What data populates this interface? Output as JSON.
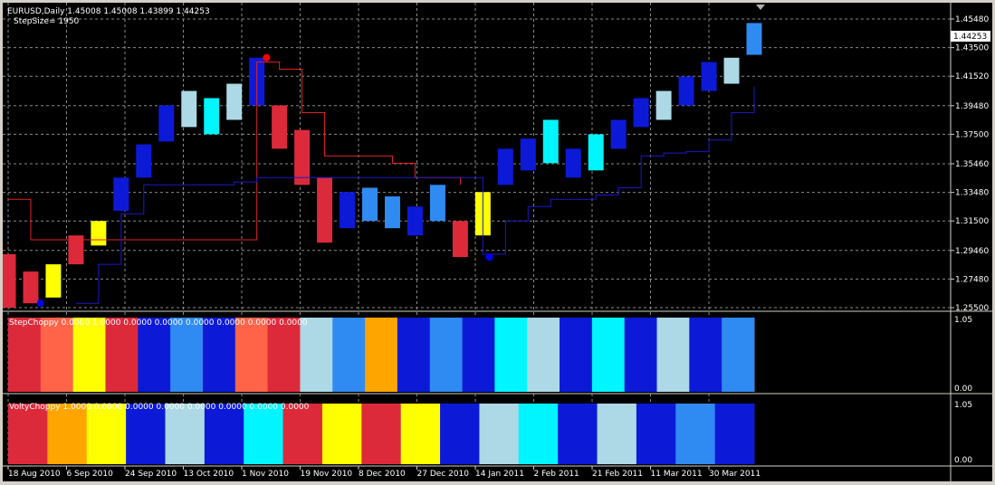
{
  "chart_data": {
    "type": "bar",
    "symbol_line": "EURUSD,Daily  1.45008 1.45008 1.43899 1.44253",
    "step_size_label": "StepSize= 1950",
    "current_price": "1.44253",
    "y_ticks": [
      "1.45480",
      "1.43500",
      "1.41520",
      "1.39480",
      "1.37500",
      "1.35460",
      "1.33480",
      "1.31500",
      "1.29460",
      "1.27480",
      "1.25500"
    ],
    "x_ticks": [
      "18 Aug 2010",
      "6 Sep 2010",
      "24 Sep 2010",
      "13 Oct 2010",
      "1 Nov 2010",
      "19 Nov 2010",
      "8 Dec 2010",
      "27 Dec 2010",
      "14 Jan 2011",
      "2 Feb 2011",
      "21 Feb 2011",
      "11 Mar 2011",
      "30 Mar 2011"
    ],
    "ylim": [
      1.255,
      1.4548
    ],
    "colors": {
      "red": "#dc2a3b",
      "orange_red": "#ff6348",
      "orange": "#ffa500",
      "yellow": "#ffff00",
      "blue": "#0c1ad8",
      "dodger_blue": "#2f8bf2",
      "cyan": "#00f5ff",
      "light_blue": "#add8e6",
      "red_line": "#e32222",
      "blue_line": "#1a1ac8",
      "grid": "#8a8a8a"
    },
    "price_series": {
      "name": "EURUSD",
      "x": [
        "2010-08-16",
        "2010-08-23",
        "2010-08-30",
        "2010-09-06",
        "2010-09-13",
        "2010-09-20",
        "2010-09-27",
        "2010-10-04",
        "2010-10-11",
        "2010-10-18",
        "2010-10-25",
        "2010-11-01",
        "2010-11-08",
        "2010-11-15",
        "2010-11-22",
        "2010-11-29",
        "2010-12-06",
        "2010-12-13",
        "2010-12-20",
        "2010-12-27",
        "2011-01-03",
        "2011-01-10",
        "2011-01-17",
        "2011-01-24",
        "2011-01-31",
        "2011-02-07",
        "2011-02-14",
        "2011-02-21",
        "2011-02-28",
        "2011-03-07",
        "2011-03-14",
        "2011-03-21",
        "2011-03-28",
        "2011-04-04"
      ],
      "high": [
        1.292,
        1.28,
        1.285,
        1.305,
        1.315,
        1.345,
        1.368,
        1.395,
        1.405,
        1.4,
        1.41,
        1.428,
        1.395,
        1.378,
        1.345,
        1.335,
        1.338,
        1.332,
        1.325,
        1.34,
        1.315,
        1.335,
        1.365,
        1.372,
        1.385,
        1.365,
        1.375,
        1.385,
        1.4,
        1.405,
        1.415,
        1.425,
        1.428,
        1.452
      ],
      "low": [
        1.255,
        1.258,
        1.262,
        1.285,
        1.298,
        1.322,
        1.345,
        1.37,
        1.38,
        1.375,
        1.385,
        1.395,
        1.365,
        1.34,
        1.3,
        1.31,
        1.315,
        1.31,
        1.305,
        1.315,
        1.29,
        1.305,
        1.34,
        1.35,
        1.355,
        1.345,
        1.35,
        1.365,
        1.38,
        1.385,
        1.395,
        1.405,
        1.41,
        1.43
      ],
      "regime": [
        "red",
        "red",
        "yellow",
        "red",
        "yellow",
        "blue",
        "blue",
        "blue",
        "light_blue",
        "cyan",
        "light_blue",
        "blue",
        "red",
        "red",
        "red",
        "blue",
        "dodger_blue",
        "dodger_blue",
        "blue",
        "dodger_blue",
        "red",
        "yellow",
        "blue",
        "blue",
        "cyan",
        "blue",
        "cyan",
        "blue",
        "blue",
        "light_blue",
        "blue",
        "blue",
        "light_blue",
        "dodger_blue"
      ]
    },
    "red_stop_line": {
      "x": [
        "2010-08-16",
        "2010-08-23",
        "2010-08-30",
        "2010-09-06",
        "2010-11-01",
        "2010-11-08",
        "2010-11-15",
        "2010-11-22",
        "2010-11-29",
        "2010-12-06",
        "2010-12-13",
        "2010-12-20",
        "2010-12-27",
        "2011-01-03"
      ],
      "y": [
        1.33,
        1.302,
        1.302,
        1.302,
        1.425,
        1.42,
        1.39,
        1.36,
        1.36,
        1.36,
        1.355,
        1.345,
        1.345,
        1.34
      ]
    },
    "blue_stop_line": {
      "x": [
        "2010-09-06",
        "2010-09-13",
        "2010-09-20",
        "2010-09-27",
        "2010-10-11",
        "2010-10-25",
        "2010-11-01",
        "2011-01-10",
        "2011-01-17",
        "2011-01-24",
        "2011-01-31",
        "2011-02-14",
        "2011-02-21",
        "2011-02-28",
        "2011-03-07",
        "2011-03-14",
        "2011-03-21",
        "2011-03-28",
        "2011-04-04"
      ],
      "y": [
        1.258,
        1.285,
        1.32,
        1.34,
        1.34,
        1.342,
        1.345,
        1.292,
        1.315,
        1.325,
        1.33,
        1.333,
        1.338,
        1.36,
        1.362,
        1.363,
        1.371,
        1.39,
        1.408
      ]
    },
    "signal_dots": [
      {
        "x": "2010-08-26",
        "y": 1.258,
        "color": "blue"
      },
      {
        "x": "2010-11-04",
        "y": 1.428,
        "color": "red"
      },
      {
        "x": "2011-01-12",
        "y": 1.29,
        "color": "blue"
      }
    ],
    "step_choppy": {
      "label": "StepChoppy 0.0000 1.0000 0.0000 0.0000 0.0000 0.0000 0.0000 0.0000",
      "y_max_label": "1.05",
      "y_min_label": "0.00",
      "colors": [
        "red",
        "orange_red",
        "yellow",
        "red",
        "blue",
        "dodger_blue",
        "blue",
        "orange_red",
        "red",
        "light_blue",
        "dodger_blue",
        "orange",
        "blue",
        "dodger_blue",
        "blue",
        "cyan",
        "light_blue",
        "blue",
        "cyan",
        "blue",
        "light_blue",
        "blue",
        "dodger_blue"
      ]
    },
    "volty_choppy": {
      "label": "VoltyChoppy 1.0000 0.0000 0.0000 0.0000 0.0000 0.0000 0.0000 0.0000",
      "y_max_label": "1.05",
      "y_min_label": "0.00",
      "colors": [
        "red",
        "orange",
        "yellow",
        "blue",
        "light_blue",
        "blue",
        "cyan",
        "red",
        "yellow",
        "red",
        "yellow",
        "blue",
        "light_blue",
        "cyan",
        "blue",
        "light_blue",
        "blue",
        "dodger_blue",
        "blue"
      ]
    }
  }
}
